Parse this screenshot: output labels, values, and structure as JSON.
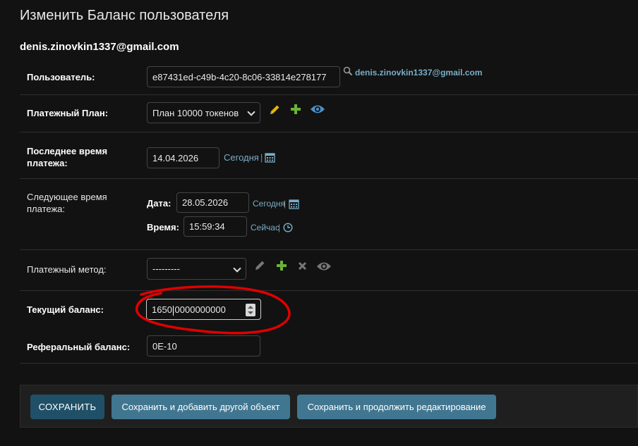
{
  "page": {
    "title": "Изменить Баланс пользователя",
    "object_name": "denis.zinovkin1337@gmail.com"
  },
  "fields": {
    "user": {
      "label": "Пользователь:",
      "value": "e87431ed-c49b-4c20-8c06-33814e278177",
      "lookup_text": "denis.zinovkin1337@gmail.com"
    },
    "plan": {
      "label": "Платежный План:",
      "selected": "План 10000 токенов"
    },
    "last_payment": {
      "label": "Последнее время платежа:",
      "date": "14.04.2026",
      "today_link": "Сегодня",
      "sep": "|"
    },
    "next_payment": {
      "label": "Следующее время платежа:",
      "date_label": "Дата:",
      "date": "28.05.2026",
      "today_link": "Сегодня",
      "time_label": "Время:",
      "time": "15:59:34",
      "now_link": "Сейчас",
      "sep": "|"
    },
    "method": {
      "label": "Платежный метод:",
      "selected": "---------"
    },
    "balance": {
      "label": "Текущий баланс:",
      "value": "1650.0000000000"
    },
    "referral": {
      "label": "Реферальный баланс:",
      "value": "0E-10"
    }
  },
  "buttons": {
    "save": "СОХРАНИТЬ",
    "save_add": "Сохранить и добавить другой объект",
    "save_continue": "Сохранить и продолжить редактирование"
  },
  "colors": {
    "background": "#121212",
    "link": "#79aec8",
    "primary_button": "#205067",
    "secondary_button": "#417690",
    "edit_pencil": "#e8b400",
    "add_plus": "#6bb335",
    "view_eye": "#4a90c8",
    "annotation": "#e00000"
  },
  "icons": [
    "search-icon",
    "pencil-icon",
    "plus-icon",
    "eye-icon",
    "calendar-icon",
    "clock-icon",
    "delete-icon"
  ]
}
